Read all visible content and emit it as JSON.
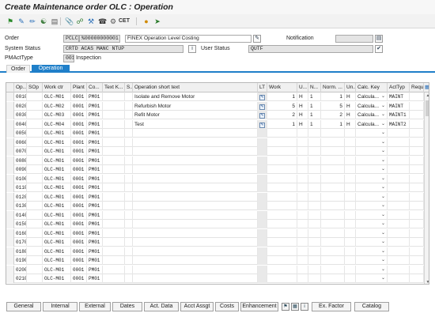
{
  "window": {
    "title": "Create Maintenance order OLC : Operation"
  },
  "toolbar": {
    "icons": [
      "flag-icon",
      "create-icon",
      "edit-icon",
      "display-icon",
      "document-icon",
      "link-icon",
      "tools-icon",
      "headset-icon",
      "settings-icon"
    ],
    "cet_label": "CET"
  },
  "header": {
    "order_label": "Order",
    "order_type": "PCLC",
    "order_number": "%00000000001",
    "order_description": "FINEX Operation Level Costing",
    "notification_label": "Notification",
    "notification_value": "",
    "system_status_label": "System Status",
    "system_status_value": "CRTD ACAS MANC NTUP",
    "user_status_label": "User Status",
    "user_status_value": "QUTF",
    "pmacttype_label": "PMActType",
    "pmacttype_code": "001",
    "pmacttype_text": "Inspection"
  },
  "tabs": [
    {
      "label": "Order",
      "active": false
    },
    {
      "label": "Operation",
      "active": true
    }
  ],
  "grid": {
    "columns": {
      "op": "Op...",
      "sop": "SOp",
      "work_ctr": "Work ctr",
      "plant": "Plant",
      "co": "Co...",
      "text_k": "Text K...",
      "s": "S...",
      "short_text": "Operation short text",
      "lt": "LT",
      "work": "Work",
      "u": "U...",
      "n": "N...",
      "norm": "Norm. ...",
      "un": "Un...",
      "calc_key": "Calc. Key",
      "acttyp": "ActTyp",
      "req": "Requ"
    },
    "rows": [
      {
        "op": "0010",
        "work_ctr": "OLC-M01",
        "plant": "0001",
        "co": "PM01",
        "short_text": "Isolate and Remove Motor",
        "work": "1",
        "u": "H",
        "n": "1",
        "norm": "1",
        "un": "H",
        "calc_key": "Calcula...",
        "acttyp": "MAINT"
      },
      {
        "op": "0020",
        "work_ctr": "OLC-M02",
        "plant": "0001",
        "co": "PM01",
        "short_text": "Refurbish Motor",
        "work": "5",
        "u": "H",
        "n": "1",
        "norm": "5",
        "un": "H",
        "calc_key": "Calcula...",
        "acttyp": "MAINT"
      },
      {
        "op": "0030",
        "work_ctr": "OLC-M03",
        "plant": "0001",
        "co": "PM01",
        "short_text": "Refit Motor",
        "work": "2",
        "u": "H",
        "n": "1",
        "norm": "2",
        "un": "H",
        "calc_key": "Calcula...",
        "acttyp": "MAINT1"
      },
      {
        "op": "0040",
        "work_ctr": "OLC-M04",
        "plant": "0001",
        "co": "PM01",
        "short_text": "Test",
        "work": "1",
        "u": "H",
        "n": "1",
        "norm": "1",
        "un": "H",
        "calc_key": "Calcula...",
        "acttyp": "MAINT2"
      },
      {
        "op": "0050",
        "work_ctr": "OLC-M01",
        "plant": "0001",
        "co": "PM01"
      },
      {
        "op": "0060",
        "work_ctr": "OLC-M01",
        "plant": "0001",
        "co": "PM01"
      },
      {
        "op": "0070",
        "work_ctr": "OLC-M01",
        "plant": "0001",
        "co": "PM01"
      },
      {
        "op": "0080",
        "work_ctr": "OLC-M01",
        "plant": "0001",
        "co": "PM01"
      },
      {
        "op": "0090",
        "work_ctr": "OLC-M01",
        "plant": "0001",
        "co": "PM01"
      },
      {
        "op": "0100",
        "work_ctr": "OLC-M01",
        "plant": "0001",
        "co": "PM01"
      },
      {
        "op": "0110",
        "work_ctr": "OLC-M01",
        "plant": "0001",
        "co": "PM01"
      },
      {
        "op": "0120",
        "work_ctr": "OLC-M01",
        "plant": "0001",
        "co": "PM01"
      },
      {
        "op": "0130",
        "work_ctr": "OLC-M01",
        "plant": "0001",
        "co": "PM01"
      },
      {
        "op": "0140",
        "work_ctr": "OLC-M01",
        "plant": "0001",
        "co": "PM01"
      },
      {
        "op": "0150",
        "work_ctr": "OLC-M01",
        "plant": "0001",
        "co": "PM01"
      },
      {
        "op": "0160",
        "work_ctr": "OLC-M01",
        "plant": "0001",
        "co": "PM01"
      },
      {
        "op": "0170",
        "work_ctr": "OLC-M01",
        "plant": "0001",
        "co": "PM01"
      },
      {
        "op": "0180",
        "work_ctr": "OLC-M01",
        "plant": "0001",
        "co": "PM01"
      },
      {
        "op": "0190",
        "work_ctr": "OLC-M01",
        "plant": "0001",
        "co": "PM01"
      },
      {
        "op": "0200",
        "work_ctr": "OLC-M01",
        "plant": "0001",
        "co": "PM01"
      },
      {
        "op": "0210",
        "work_ctr": "OLC-M01",
        "plant": "0001",
        "co": "PM01"
      }
    ]
  },
  "bottom_buttons": {
    "general": "General",
    "internal": "Internal",
    "external": "External",
    "dates": "Dates",
    "act_data": "Act. Data",
    "acct_assgt": "Acct Assgt",
    "costs": "Costs",
    "enhancement": "Enhancement",
    "ex_factor": "Ex. Factor",
    "catalog": "Catalog"
  },
  "colors": {
    "accent": "#1f7fc9",
    "title_text": "#222222",
    "field_border": "#a8a8a8"
  }
}
